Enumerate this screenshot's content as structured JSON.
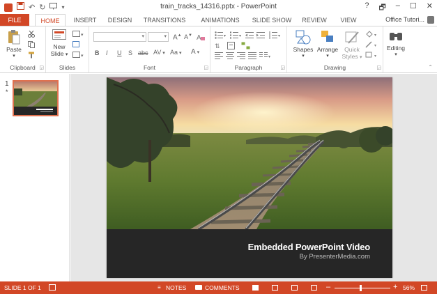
{
  "titlebar": {
    "title": "train_tracks_14316.pptx - PowerPoint",
    "qat_icons": [
      "powerpoint-logo-icon",
      "save-icon",
      "undo-icon",
      "redo-icon",
      "start-slideshow-icon",
      "customize-qat-icon"
    ],
    "help": "?",
    "restore": "🗗",
    "minimize": "–",
    "maximize": "☐",
    "close": "✕"
  },
  "tabs": {
    "file": "FILE",
    "home": "HOME",
    "insert": "INSERT",
    "design": "DESIGN",
    "transitions": "TRANSITIONS",
    "animations": "ANIMATIONS",
    "slideshow": "SLIDE SHOW",
    "review": "REVIEW",
    "view": "VIEW",
    "account": "Office Tutori..."
  },
  "ribbon": {
    "clipboard": {
      "label": "Clipboard",
      "paste": "Paste"
    },
    "slides": {
      "label": "Slides",
      "new_slide_line1": "New",
      "new_slide_line2": "Slide"
    },
    "font": {
      "label": "Font",
      "bold": "B",
      "italic": "I",
      "underline": "U",
      "strike": "S",
      "shadow": "abc",
      "spacing": "AV",
      "case": "Aa",
      "color": "A"
    },
    "paragraph": {
      "label": "Paragraph"
    },
    "drawing": {
      "label": "Drawing",
      "shapes": "Shapes",
      "arrange": "Arrange",
      "quick_styles_line1": "Quick",
      "quick_styles_line2": "Styles"
    },
    "editing": {
      "label": "Editing"
    }
  },
  "thumbnails": {
    "slide_number": "1",
    "marker": "*"
  },
  "slide": {
    "caption_title": "Embedded PowerPoint Video",
    "caption_sub": "By PresenterMedia.com"
  },
  "statusbar": {
    "slide_of": "SLIDE 1 OF 1",
    "notes": "NOTES",
    "comments": "COMMENTS",
    "zoom_minus": "–",
    "zoom_plus": "+",
    "zoom": "56%",
    "zoom_level": 0.56
  },
  "colors": {
    "accent": "#d24726",
    "caption_bg": "#262626"
  }
}
